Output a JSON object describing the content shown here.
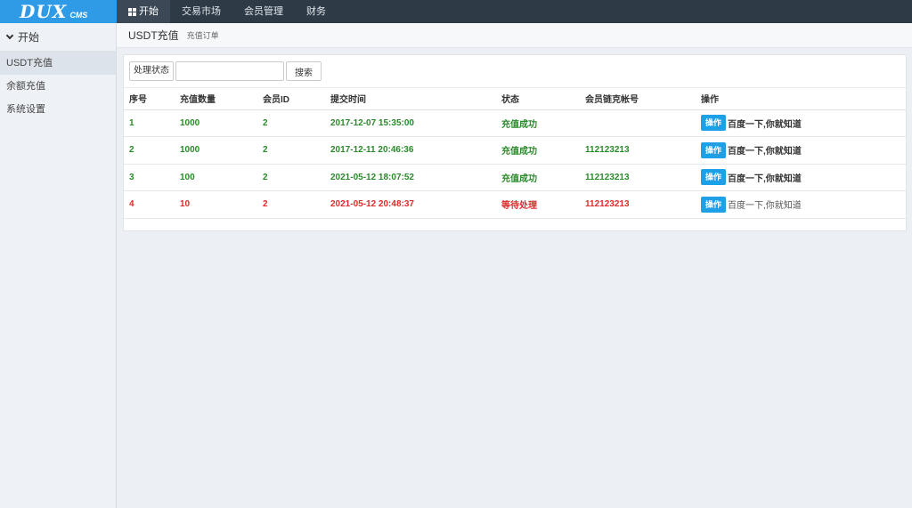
{
  "logo": {
    "main": "DUX",
    "sub": "CMS"
  },
  "nav": [
    {
      "label": "开始",
      "icon": "windows-icon"
    },
    {
      "label": "交易市场"
    },
    {
      "label": "会员管理"
    },
    {
      "label": "财务"
    }
  ],
  "sidebar": {
    "head": "开始",
    "items": [
      {
        "label": "USDT充值"
      },
      {
        "label": "余额充值"
      },
      {
        "label": "系统设置"
      }
    ]
  },
  "breadcrumb": {
    "title": "USDT充值",
    "subtitle": "充值订单"
  },
  "filter": {
    "select_value": "处理状态",
    "input_value": "",
    "search_label": "搜索"
  },
  "table": {
    "headers": [
      "序号",
      "充值数量",
      "会员ID",
      "提交时间",
      "状态",
      "会员链克帐号",
      "操作"
    ],
    "rows": [
      {
        "id": "1",
        "amount": "1000",
        "member": "2",
        "time": "2017-12-07 15:35:00",
        "status": "充值成功",
        "account": "",
        "op": "操作",
        "link": "百度一下,你就知道",
        "state": "ok"
      },
      {
        "id": "2",
        "amount": "1000",
        "member": "2",
        "time": "2017-12-11 20:46:36",
        "status": "充值成功",
        "account": "112123213",
        "op": "操作",
        "link": "百度一下,你就知道",
        "state": "ok"
      },
      {
        "id": "3",
        "amount": "100",
        "member": "2",
        "time": "2021-05-12 18:07:52",
        "status": "充值成功",
        "account": "112123213",
        "op": "操作",
        "link": "百度一下,你就知道",
        "state": "ok"
      },
      {
        "id": "4",
        "amount": "10",
        "member": "2",
        "time": "2021-05-12 20:48:37",
        "status": "等待处理",
        "account": "112123213",
        "op": "操作",
        "link": "百度一下,你就知道",
        "state": "wait"
      }
    ]
  },
  "colors": {
    "brand": "#2f9be6",
    "topbar": "#2f3a47",
    "success": "#2a8a2a",
    "pending": "#e02a2a",
    "button": "#1ea0e8"
  }
}
